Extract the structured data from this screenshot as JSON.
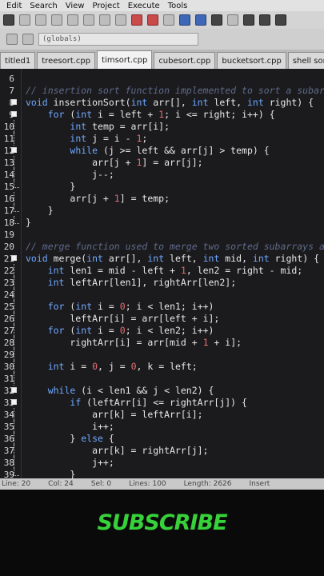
{
  "menu": [
    "Edit",
    "Search",
    "View",
    "Project",
    "Execute",
    "Tools"
  ],
  "globals": "(globals)",
  "tabs": [
    "titled1",
    "treesort.cpp",
    "timsort.cpp",
    "cubesort.cpp",
    "bucketsort.cpp",
    "shell sort algorith"
  ],
  "active_tab_index": 2,
  "colors": {
    "keyword": "#6fa8ff",
    "number": "#e07070",
    "comment": "#5f6a8a",
    "text": "#e8e8e8",
    "subscribe": "#37d13a"
  },
  "code_lines": [
    {
      "n": "6",
      "fold": "",
      "segs": [
        {
          "t": ""
        }
      ]
    },
    {
      "n": "7",
      "fold": "",
      "segs": [
        {
          "t": "// insertion sort function implemented to sort a subar",
          "c": "cm"
        }
      ]
    },
    {
      "n": "8",
      "fold": "box",
      "segs": [
        {
          "t": "void ",
          "c": "kw"
        },
        {
          "t": "insertionSort("
        },
        {
          "t": "int ",
          "c": "kw"
        },
        {
          "t": "arr[], "
        },
        {
          "t": "int ",
          "c": "kw"
        },
        {
          "t": "left, "
        },
        {
          "t": "int ",
          "c": "kw"
        },
        {
          "t": "right) {"
        }
      ]
    },
    {
      "n": "9",
      "fold": "box",
      "segs": [
        {
          "t": "    "
        },
        {
          "t": "for ",
          "c": "kw"
        },
        {
          "t": "("
        },
        {
          "t": "int ",
          "c": "kw"
        },
        {
          "t": "i = left + "
        },
        {
          "t": "1",
          "c": "num"
        },
        {
          "t": "; i <= right; i++) {"
        }
      ]
    },
    {
      "n": "10",
      "fold": "vline",
      "segs": [
        {
          "t": "        "
        },
        {
          "t": "int ",
          "c": "kw"
        },
        {
          "t": "temp = arr[i];"
        }
      ]
    },
    {
      "n": "11",
      "fold": "vline",
      "segs": [
        {
          "t": "        "
        },
        {
          "t": "int ",
          "c": "kw"
        },
        {
          "t": "j = i - "
        },
        {
          "t": "1",
          "c": "num"
        },
        {
          "t": ";"
        }
      ]
    },
    {
      "n": "12",
      "fold": "box",
      "segs": [
        {
          "t": "        "
        },
        {
          "t": "while ",
          "c": "kw"
        },
        {
          "t": "(j >= left && arr[j] > temp) {"
        }
      ]
    },
    {
      "n": "13",
      "fold": "vline",
      "segs": [
        {
          "t": "            arr[j + "
        },
        {
          "t": "1",
          "c": "num"
        },
        {
          "t": "] = arr[j];"
        }
      ]
    },
    {
      "n": "14",
      "fold": "vline",
      "segs": [
        {
          "t": "            j--;"
        }
      ]
    },
    {
      "n": "15",
      "fold": "end",
      "segs": [
        {
          "t": "        }"
        }
      ]
    },
    {
      "n": "16",
      "fold": "vline",
      "segs": [
        {
          "t": "        arr[j + "
        },
        {
          "t": "1",
          "c": "num"
        },
        {
          "t": "] = temp;"
        }
      ]
    },
    {
      "n": "17",
      "fold": "end",
      "segs": [
        {
          "t": "    }"
        }
      ]
    },
    {
      "n": "18",
      "fold": "end",
      "segs": [
        {
          "t": "}"
        }
      ]
    },
    {
      "n": "19",
      "fold": "",
      "segs": [
        {
          "t": ""
        }
      ]
    },
    {
      "n": "20",
      "fold": "",
      "segs": [
        {
          "t": "// merge function used to merge two sorted subarrays a",
          "c": "cm"
        }
      ]
    },
    {
      "n": "21",
      "fold": "box",
      "segs": [
        {
          "t": "void ",
          "c": "kw"
        },
        {
          "t": "merge("
        },
        {
          "t": "int ",
          "c": "kw"
        },
        {
          "t": "arr[], "
        },
        {
          "t": "int ",
          "c": "kw"
        },
        {
          "t": "left, "
        },
        {
          "t": "int ",
          "c": "kw"
        },
        {
          "t": "mid, "
        },
        {
          "t": "int ",
          "c": "kw"
        },
        {
          "t": "right) {"
        }
      ]
    },
    {
      "n": "22",
      "fold": "vline",
      "segs": [
        {
          "t": "    "
        },
        {
          "t": "int ",
          "c": "kw"
        },
        {
          "t": "len1 = mid - left + "
        },
        {
          "t": "1",
          "c": "num"
        },
        {
          "t": ", len2 = right - mid;"
        }
      ]
    },
    {
      "n": "23",
      "fold": "vline",
      "segs": [
        {
          "t": "    "
        },
        {
          "t": "int ",
          "c": "kw"
        },
        {
          "t": "leftArr[len1], rightArr[len2];"
        }
      ]
    },
    {
      "n": "24",
      "fold": "vline",
      "segs": [
        {
          "t": ""
        }
      ]
    },
    {
      "n": "25",
      "fold": "vline",
      "segs": [
        {
          "t": "    "
        },
        {
          "t": "for ",
          "c": "kw"
        },
        {
          "t": "("
        },
        {
          "t": "int ",
          "c": "kw"
        },
        {
          "t": "i = "
        },
        {
          "t": "0",
          "c": "num"
        },
        {
          "t": "; i < len1; i++)"
        }
      ]
    },
    {
      "n": "26",
      "fold": "vline",
      "segs": [
        {
          "t": "        leftArr[i] = arr[left + i];"
        }
      ]
    },
    {
      "n": "27",
      "fold": "vline",
      "segs": [
        {
          "t": "    "
        },
        {
          "t": "for ",
          "c": "kw"
        },
        {
          "t": "("
        },
        {
          "t": "int ",
          "c": "kw"
        },
        {
          "t": "i = "
        },
        {
          "t": "0",
          "c": "num"
        },
        {
          "t": "; i < len2; i++)"
        }
      ]
    },
    {
      "n": "28",
      "fold": "vline",
      "segs": [
        {
          "t": "        rightArr[i] = arr[mid + "
        },
        {
          "t": "1",
          "c": "num"
        },
        {
          "t": " + i];"
        }
      ]
    },
    {
      "n": "29",
      "fold": "vline",
      "segs": [
        {
          "t": ""
        }
      ]
    },
    {
      "n": "30",
      "fold": "vline",
      "segs": [
        {
          "t": "    "
        },
        {
          "t": "int ",
          "c": "kw"
        },
        {
          "t": "i = "
        },
        {
          "t": "0",
          "c": "num"
        },
        {
          "t": ", j = "
        },
        {
          "t": "0",
          "c": "num"
        },
        {
          "t": ", k = left;"
        }
      ]
    },
    {
      "n": "31",
      "fold": "vline",
      "segs": [
        {
          "t": ""
        }
      ]
    },
    {
      "n": "32",
      "fold": "box",
      "segs": [
        {
          "t": "    "
        },
        {
          "t": "while ",
          "c": "kw"
        },
        {
          "t": "(i < len1 && j < len2) {"
        }
      ]
    },
    {
      "n": "33",
      "fold": "box",
      "segs": [
        {
          "t": "        "
        },
        {
          "t": "if ",
          "c": "kw"
        },
        {
          "t": "(leftArr[i] <= rightArr[j]) {"
        }
      ]
    },
    {
      "n": "34",
      "fold": "vline",
      "segs": [
        {
          "t": "            arr[k] = leftArr[i];"
        }
      ]
    },
    {
      "n": "35",
      "fold": "vline",
      "segs": [
        {
          "t": "            i++;"
        }
      ]
    },
    {
      "n": "36",
      "fold": "vline",
      "segs": [
        {
          "t": "        } "
        },
        {
          "t": "else ",
          "c": "kw"
        },
        {
          "t": "{"
        }
      ]
    },
    {
      "n": "37",
      "fold": "vline",
      "segs": [
        {
          "t": "            arr[k] = rightArr[j];"
        }
      ]
    },
    {
      "n": "38",
      "fold": "vline",
      "segs": [
        {
          "t": "            j++;"
        }
      ]
    },
    {
      "n": "39",
      "fold": "end",
      "segs": [
        {
          "t": "        }"
        }
      ]
    }
  ],
  "status": {
    "line": "Line: 20",
    "col": "Col: 24",
    "sel": "Sel: 0",
    "lines": "Lines: 100",
    "length": "Length: 2626",
    "mode": "Insert"
  },
  "subscribe": "SUBSCRIBE"
}
